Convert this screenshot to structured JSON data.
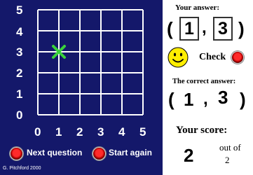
{
  "grid": {
    "y_labels": [
      "5",
      "4",
      "3",
      "2",
      "1",
      "0"
    ],
    "x_labels": [
      "0",
      "1",
      "2",
      "3",
      "4",
      "5"
    ],
    "marker": {
      "x": 1,
      "y": 3,
      "glyph": "x-mark",
      "color": "#39d13b"
    }
  },
  "buttons": {
    "next_question": "Next question",
    "start_again": "Start again"
  },
  "credit": "G. Pitchford 2000",
  "answer": {
    "heading": "Your answer:",
    "x": "1",
    "y": "3"
  },
  "check": {
    "label": "Check",
    "feedback_icon": "smiley-face-icon"
  },
  "correct": {
    "heading": "The correct answer:",
    "x": "1",
    "y": "3"
  },
  "score": {
    "heading": "Your score:",
    "value": "2",
    "out_of_label": "out of",
    "total": "2"
  },
  "colors": {
    "panel": "#14186a",
    "grid_line": "#ffffff",
    "marker": "#39d13b",
    "button": "#e00000",
    "smiley": "#ffee00"
  }
}
